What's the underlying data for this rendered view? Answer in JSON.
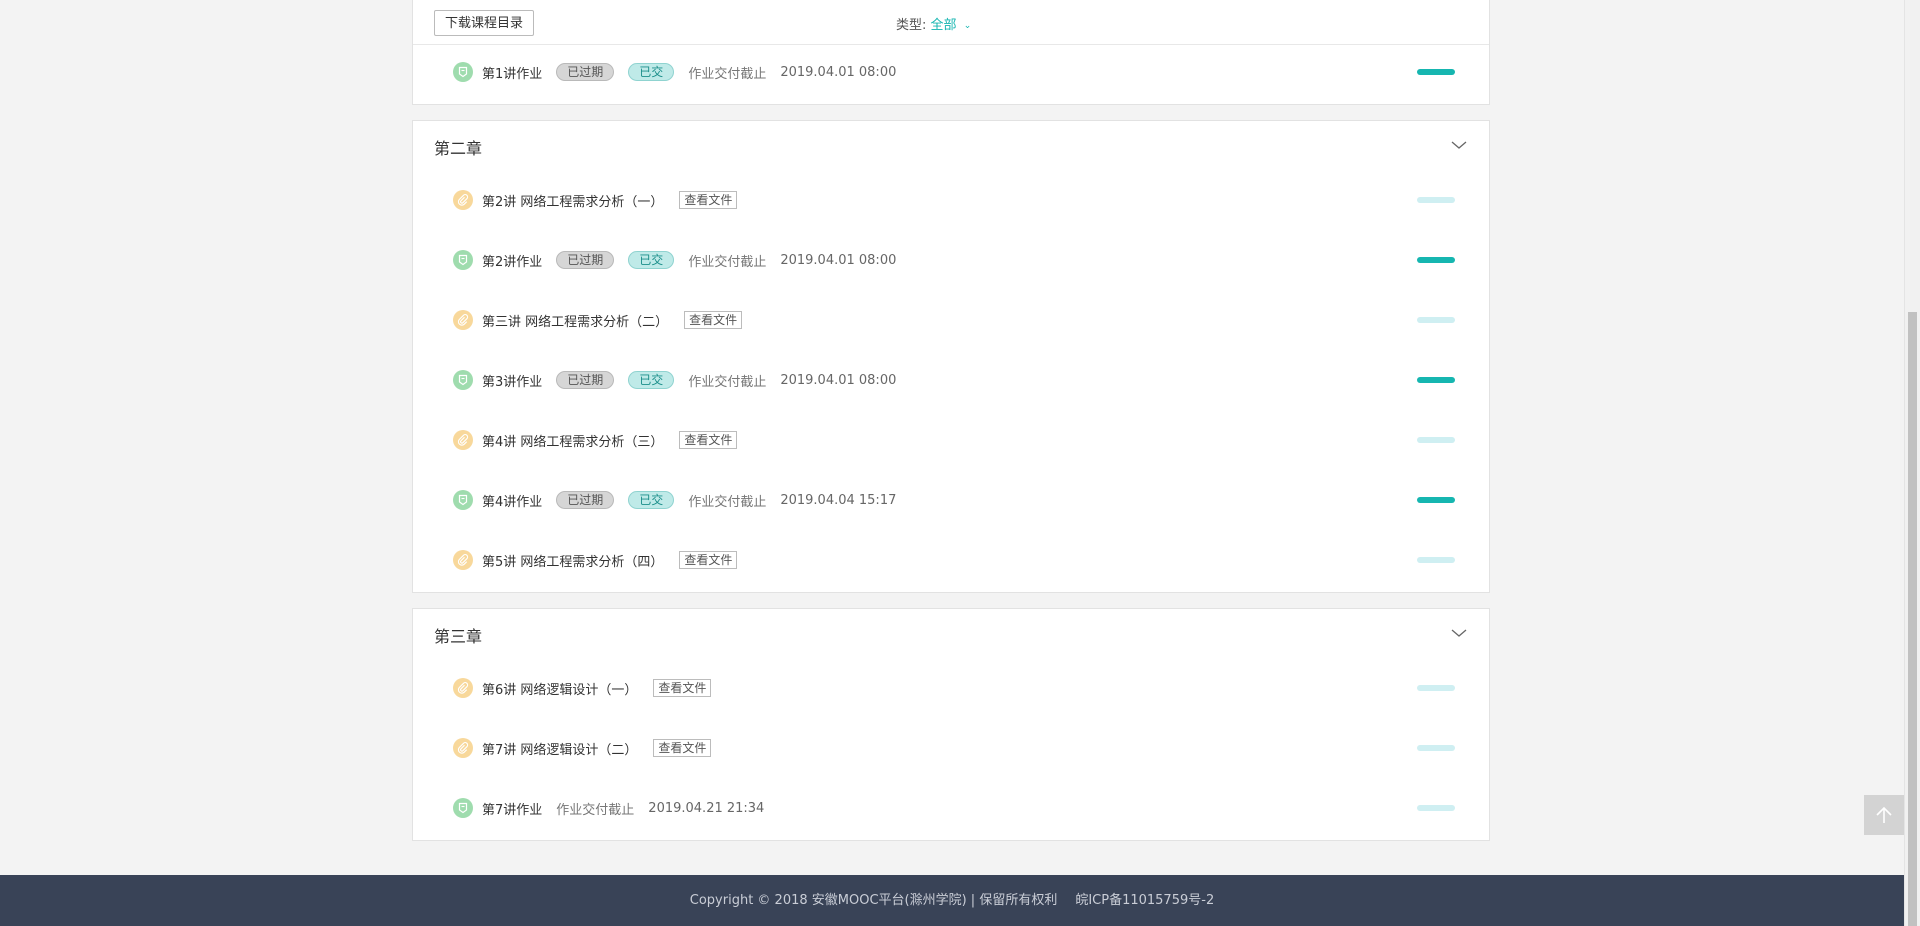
{
  "toolbar": {
    "download_label": "下载课程目录",
    "type_label": "类型:",
    "type_value": "全部"
  },
  "top_rows": [
    {
      "kind": "homework",
      "name": "第1讲作业",
      "expired": "已过期",
      "status": "已交",
      "deadline_label": "作业交付截止",
      "deadline": "2019.04.01 08:00",
      "completed": true
    }
  ],
  "chapters": [
    {
      "title": "第二章",
      "rows": [
        {
          "kind": "file",
          "name": "第2讲 网络工程需求分析（一）",
          "action": "查看文件",
          "completed": false
        },
        {
          "kind": "homework",
          "name": "第2讲作业",
          "expired": "已过期",
          "status": "已交",
          "deadline_label": "作业交付截止",
          "deadline": "2019.04.01 08:00",
          "completed": true
        },
        {
          "kind": "file",
          "name": "第三讲 网络工程需求分析（二）",
          "action": "查看文件",
          "completed": false
        },
        {
          "kind": "homework",
          "name": "第3讲作业",
          "expired": "已过期",
          "status": "已交",
          "deadline_label": "作业交付截止",
          "deadline": "2019.04.01 08:00",
          "completed": true
        },
        {
          "kind": "file",
          "name": "第4讲 网络工程需求分析（三）",
          "action": "查看文件",
          "completed": false
        },
        {
          "kind": "homework",
          "name": "第4讲作业",
          "expired": "已过期",
          "status": "已交",
          "deadline_label": "作业交付截止",
          "deadline": "2019.04.04 15:17",
          "completed": true
        },
        {
          "kind": "file",
          "name": "第5讲 网络工程需求分析（四）",
          "action": "查看文件",
          "completed": false
        }
      ]
    },
    {
      "title": "第三章",
      "rows": [
        {
          "kind": "file",
          "name": "第6讲 网络逻辑设计（一）",
          "action": "查看文件",
          "completed": false
        },
        {
          "kind": "file",
          "name": "第7讲 网络逻辑设计（二）",
          "action": "查看文件",
          "completed": false
        },
        {
          "kind": "homework",
          "name": "第7讲作业",
          "deadline_label": "作业交付截止",
          "deadline": "2019.04.21 21:34",
          "completed": false
        }
      ]
    }
  ],
  "footer": {
    "copyright": "Copyright © 2018 安徽MOOC平台(滁州学院) | 保留所有权利",
    "icp": "皖ICP备11015759号-2"
  },
  "colors": {
    "accent": "#16b6b0",
    "footer_bg": "#394357",
    "homework_icon": "#9fdcae",
    "file_icon": "#f8d89b"
  },
  "icons": {
    "homework": "badge-icon",
    "file": "paperclip-icon",
    "toggle": "chevron-down-icon",
    "back_top": "arrow-up-icon"
  }
}
